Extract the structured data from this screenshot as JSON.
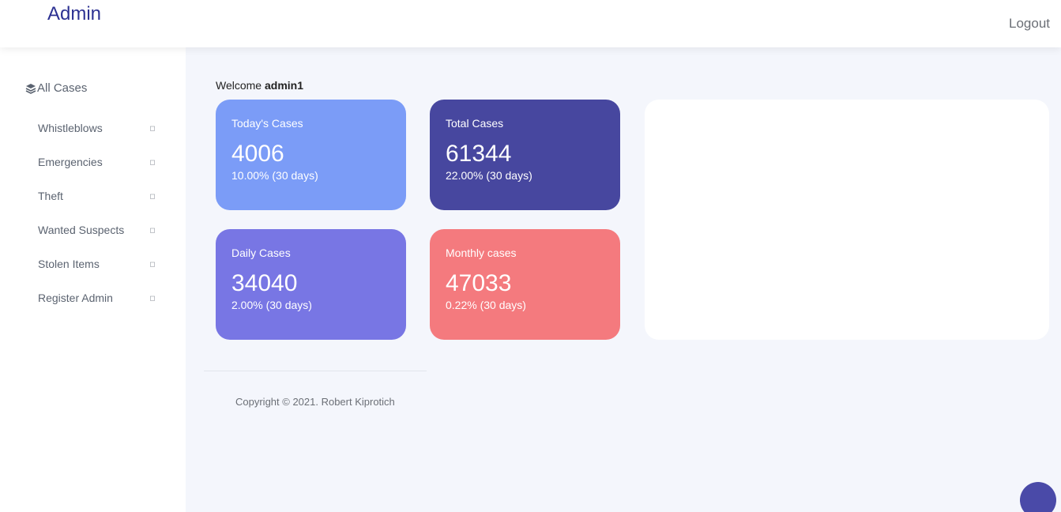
{
  "header": {
    "brand": "Admin",
    "logout_label": "Logout"
  },
  "sidebar": {
    "title": "All Cases",
    "title_icon": "layers-icon",
    "items": [
      {
        "label": "Whistleblows",
        "icon": "chevron-icon"
      },
      {
        "label": "Emergencies",
        "icon": "chevron-icon"
      },
      {
        "label": "Theft",
        "icon": "chevron-icon"
      },
      {
        "label": "Wanted Suspects",
        "icon": "chevron-icon"
      },
      {
        "label": "Stolen Items",
        "icon": "chevron-icon"
      },
      {
        "label": "Register Admin",
        "icon": "chevron-icon"
      }
    ]
  },
  "main": {
    "welcome_prefix": "Welcome",
    "username": "admin1",
    "cards": [
      {
        "title": "Today's Cases",
        "value": "4006",
        "change": "10.00% (30 days)",
        "color": "#7b9cf7"
      },
      {
        "title": "Total Cases",
        "value": "61344",
        "change": "22.00% (30 days)",
        "color": "#47479f"
      },
      {
        "title": "Daily Cases",
        "value": "34040",
        "change": "2.00% (30 days)",
        "color": "#7876e4"
      },
      {
        "title": "Monthly cases",
        "value": "47033",
        "change": "0.22% (30 days)",
        "color": "#f47a7e"
      }
    ]
  },
  "footer": {
    "copyright": "Copyright © 2021. Robert Kiprotich"
  },
  "colors": {
    "brand": "#2c3192",
    "background": "#f4f6fc",
    "fab": "#4a4aa8"
  }
}
